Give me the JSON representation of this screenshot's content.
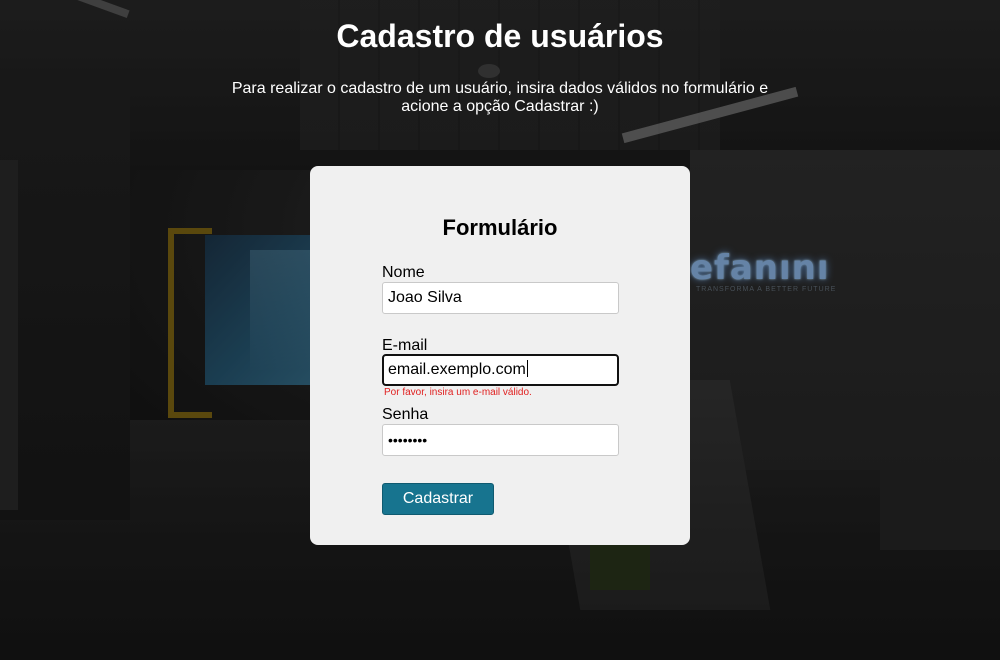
{
  "header": {
    "title": "Cadastro de usuários",
    "subtitle": "Para realizar o cadastro de um usuário, insira dados válidos no formulário e acione a opção Cadastrar :)"
  },
  "background": {
    "brand_text": "efanını",
    "brand_tagline": "TRANSFORMA A BETTER FUTURE"
  },
  "form": {
    "title": "Formulário",
    "fields": {
      "name": {
        "label": "Nome",
        "value": "Joao Silva"
      },
      "email": {
        "label": "E-mail",
        "value": "email.exemplo.com",
        "error": "Por favor, insira um e-mail válido."
      },
      "password": {
        "label": "Senha",
        "value": "••••••••"
      }
    },
    "submit_label": "Cadastrar"
  },
  "colors": {
    "button": "#17748f",
    "error": "#e02020",
    "card": "#f0f0f0"
  }
}
